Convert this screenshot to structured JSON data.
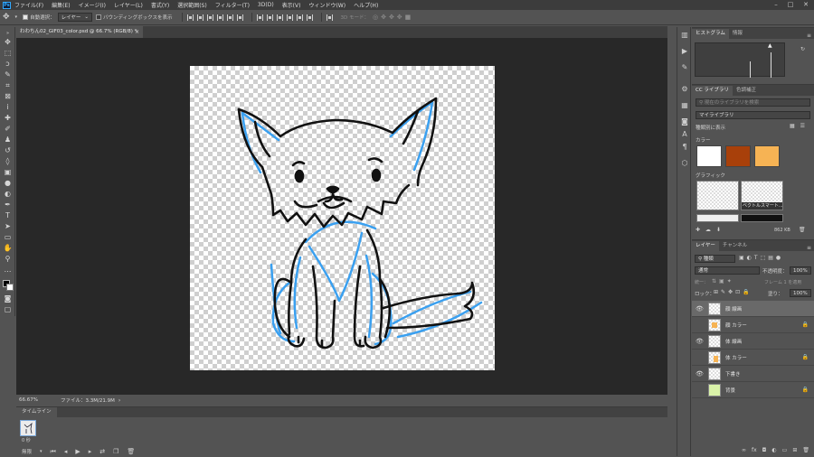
{
  "menu": [
    "ファイル(F)",
    "編集(E)",
    "イメージ(I)",
    "レイヤー(L)",
    "書式(Y)",
    "選択範囲(S)",
    "フィルター(T)",
    "3D(D)",
    "表示(V)",
    "ウィンドウ(W)",
    "ヘルプ(H)"
  ],
  "options": {
    "auto_select_label": "自動選択：",
    "auto_select_value": "レイヤー",
    "bounding_box_label": "バウンディングボックスを表示",
    "mode_3d": "3D モード："
  },
  "doc_tab": "わわちん02_GIF03_color.psd @ 66.7% (RGB/8) *",
  "status": {
    "zoom": "66.67%",
    "file_info": "ファイル：3.3M/21.9M"
  },
  "timeline": {
    "title": "タイムライン",
    "frame_delay": "0 秒",
    "loop_mode": "無限"
  },
  "histogram": {
    "tabs": [
      "ヒストグラム",
      "情報"
    ]
  },
  "libraries": {
    "tabs": [
      "CC ライブラリ",
      "色調補正"
    ],
    "search_placeholder": "現在のライブラリを検索",
    "library_name": "マイライブラリ",
    "view_label": "種類別に表示",
    "colors_heading": "カラー",
    "colors": [
      "#ffffff",
      "#a8400a",
      "#f6b354"
    ],
    "graphics_heading": "グラフィック",
    "graphic_caption": "ベクトルスマート...",
    "size_label": "862 KB"
  },
  "layers": {
    "tabs": [
      "レイヤー",
      "チャンネル"
    ],
    "kind_filter": "種類",
    "blend_mode": "通常",
    "opacity_label": "不透明度：",
    "opacity_value": "100%",
    "lock_label": "ロック：",
    "fill_label": "塗り：",
    "fill_value": "100%",
    "unify_label": "統一：",
    "propagate_label": "フレーム 1 を適用",
    "rows": [
      {
        "name": "顔 線画",
        "visible": true,
        "locked": false,
        "selected": true
      },
      {
        "name": "顔 カラー",
        "visible": false,
        "locked": true,
        "selected": false
      },
      {
        "name": "体 線画",
        "visible": true,
        "locked": false,
        "selected": false
      },
      {
        "name": "体 カラー",
        "visible": false,
        "locked": true,
        "selected": false
      },
      {
        "name": "下書き",
        "visible": true,
        "locked": false,
        "selected": false
      },
      {
        "name": "背景",
        "visible": false,
        "locked": true,
        "selected": false
      }
    ]
  }
}
